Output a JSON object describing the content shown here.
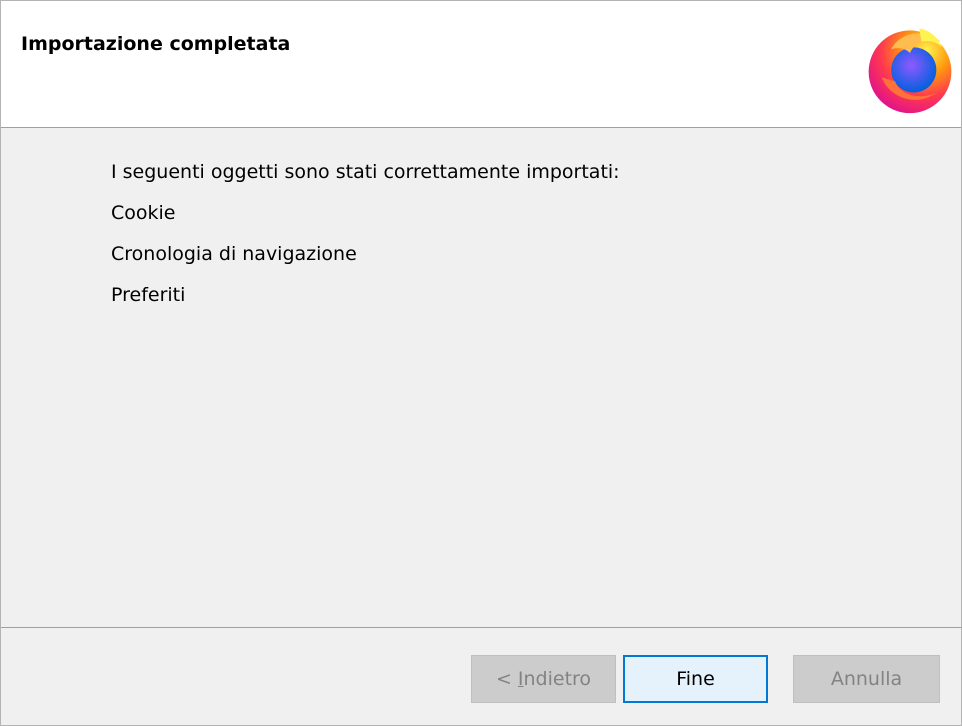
{
  "header": {
    "title": "Importazione completata",
    "logo_icon": "firefox-logo-icon"
  },
  "main": {
    "intro": "I seguenti oggetti sono stati correttamente importati:",
    "items": [
      "Cookie",
      "Cronologia di navigazione",
      "Preferiti"
    ]
  },
  "footer": {
    "back_prefix": "< ",
    "back_accel": "I",
    "back_rest": "ndietro",
    "finish_label": "Fine",
    "cancel_label": "Annulla"
  },
  "colors": {
    "focus_border": "#0078d7",
    "dialog_bg": "#f0f0f0"
  }
}
